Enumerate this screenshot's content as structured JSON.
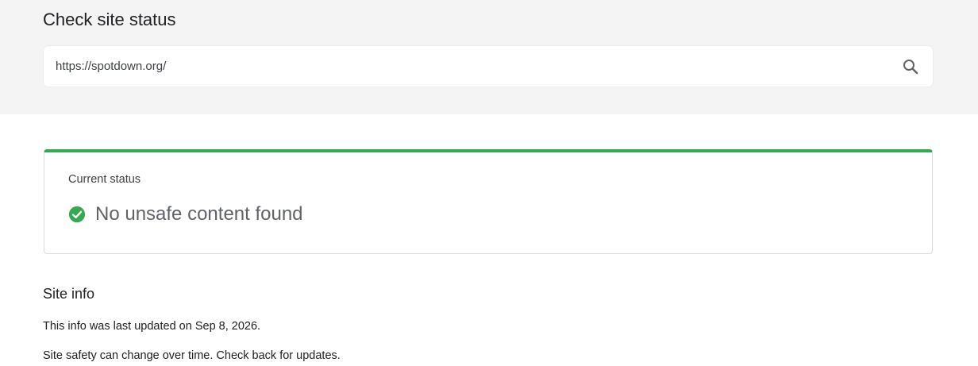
{
  "header": {
    "title": "Check site status"
  },
  "search": {
    "value": "https://spotdown.org/",
    "icon": "search-icon"
  },
  "status_card": {
    "label": "Current status",
    "status_text": "No unsafe content found",
    "status_icon": "check-circle-icon",
    "accent_color": "#34a853"
  },
  "site_info": {
    "heading": "Site info",
    "last_updated": "This info was last updated on Sep 8, 2026.",
    "note": "Site safety can change over time. Check back for updates."
  }
}
